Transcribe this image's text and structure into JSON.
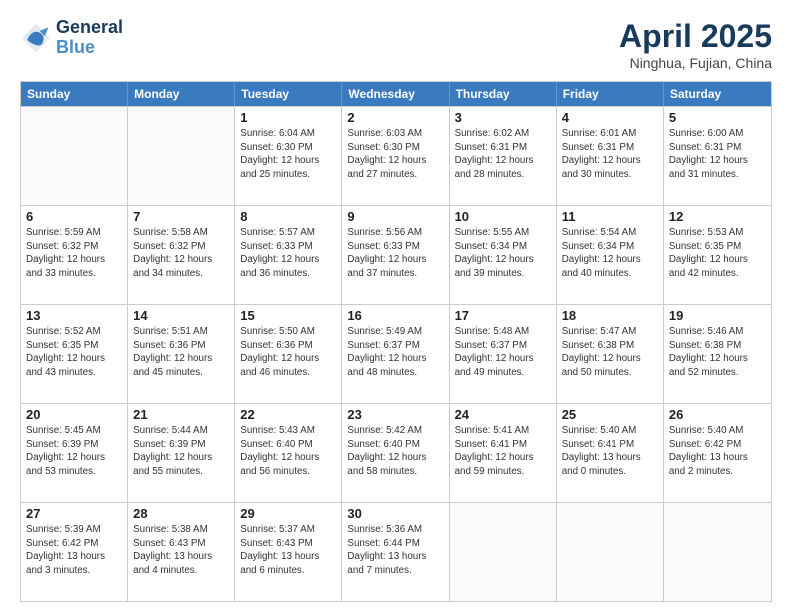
{
  "header": {
    "logo_line1": "General",
    "logo_line2": "Blue",
    "month": "April 2025",
    "location": "Ninghua, Fujian, China"
  },
  "days_of_week": [
    "Sunday",
    "Monday",
    "Tuesday",
    "Wednesday",
    "Thursday",
    "Friday",
    "Saturday"
  ],
  "weeks": [
    [
      {
        "day": "",
        "sunrise": "",
        "sunset": "",
        "daylight": ""
      },
      {
        "day": "",
        "sunrise": "",
        "sunset": "",
        "daylight": ""
      },
      {
        "day": "1",
        "sunrise": "Sunrise: 6:04 AM",
        "sunset": "Sunset: 6:30 PM",
        "daylight": "Daylight: 12 hours and 25 minutes."
      },
      {
        "day": "2",
        "sunrise": "Sunrise: 6:03 AM",
        "sunset": "Sunset: 6:30 PM",
        "daylight": "Daylight: 12 hours and 27 minutes."
      },
      {
        "day": "3",
        "sunrise": "Sunrise: 6:02 AM",
        "sunset": "Sunset: 6:31 PM",
        "daylight": "Daylight: 12 hours and 28 minutes."
      },
      {
        "day": "4",
        "sunrise": "Sunrise: 6:01 AM",
        "sunset": "Sunset: 6:31 PM",
        "daylight": "Daylight: 12 hours and 30 minutes."
      },
      {
        "day": "5",
        "sunrise": "Sunrise: 6:00 AM",
        "sunset": "Sunset: 6:31 PM",
        "daylight": "Daylight: 12 hours and 31 minutes."
      }
    ],
    [
      {
        "day": "6",
        "sunrise": "Sunrise: 5:59 AM",
        "sunset": "Sunset: 6:32 PM",
        "daylight": "Daylight: 12 hours and 33 minutes."
      },
      {
        "day": "7",
        "sunrise": "Sunrise: 5:58 AM",
        "sunset": "Sunset: 6:32 PM",
        "daylight": "Daylight: 12 hours and 34 minutes."
      },
      {
        "day": "8",
        "sunrise": "Sunrise: 5:57 AM",
        "sunset": "Sunset: 6:33 PM",
        "daylight": "Daylight: 12 hours and 36 minutes."
      },
      {
        "day": "9",
        "sunrise": "Sunrise: 5:56 AM",
        "sunset": "Sunset: 6:33 PM",
        "daylight": "Daylight: 12 hours and 37 minutes."
      },
      {
        "day": "10",
        "sunrise": "Sunrise: 5:55 AM",
        "sunset": "Sunset: 6:34 PM",
        "daylight": "Daylight: 12 hours and 39 minutes."
      },
      {
        "day": "11",
        "sunrise": "Sunrise: 5:54 AM",
        "sunset": "Sunset: 6:34 PM",
        "daylight": "Daylight: 12 hours and 40 minutes."
      },
      {
        "day": "12",
        "sunrise": "Sunrise: 5:53 AM",
        "sunset": "Sunset: 6:35 PM",
        "daylight": "Daylight: 12 hours and 42 minutes."
      }
    ],
    [
      {
        "day": "13",
        "sunrise": "Sunrise: 5:52 AM",
        "sunset": "Sunset: 6:35 PM",
        "daylight": "Daylight: 12 hours and 43 minutes."
      },
      {
        "day": "14",
        "sunrise": "Sunrise: 5:51 AM",
        "sunset": "Sunset: 6:36 PM",
        "daylight": "Daylight: 12 hours and 45 minutes."
      },
      {
        "day": "15",
        "sunrise": "Sunrise: 5:50 AM",
        "sunset": "Sunset: 6:36 PM",
        "daylight": "Daylight: 12 hours and 46 minutes."
      },
      {
        "day": "16",
        "sunrise": "Sunrise: 5:49 AM",
        "sunset": "Sunset: 6:37 PM",
        "daylight": "Daylight: 12 hours and 48 minutes."
      },
      {
        "day": "17",
        "sunrise": "Sunrise: 5:48 AM",
        "sunset": "Sunset: 6:37 PM",
        "daylight": "Daylight: 12 hours and 49 minutes."
      },
      {
        "day": "18",
        "sunrise": "Sunrise: 5:47 AM",
        "sunset": "Sunset: 6:38 PM",
        "daylight": "Daylight: 12 hours and 50 minutes."
      },
      {
        "day": "19",
        "sunrise": "Sunrise: 5:46 AM",
        "sunset": "Sunset: 6:38 PM",
        "daylight": "Daylight: 12 hours and 52 minutes."
      }
    ],
    [
      {
        "day": "20",
        "sunrise": "Sunrise: 5:45 AM",
        "sunset": "Sunset: 6:39 PM",
        "daylight": "Daylight: 12 hours and 53 minutes."
      },
      {
        "day": "21",
        "sunrise": "Sunrise: 5:44 AM",
        "sunset": "Sunset: 6:39 PM",
        "daylight": "Daylight: 12 hours and 55 minutes."
      },
      {
        "day": "22",
        "sunrise": "Sunrise: 5:43 AM",
        "sunset": "Sunset: 6:40 PM",
        "daylight": "Daylight: 12 hours and 56 minutes."
      },
      {
        "day": "23",
        "sunrise": "Sunrise: 5:42 AM",
        "sunset": "Sunset: 6:40 PM",
        "daylight": "Daylight: 12 hours and 58 minutes."
      },
      {
        "day": "24",
        "sunrise": "Sunrise: 5:41 AM",
        "sunset": "Sunset: 6:41 PM",
        "daylight": "Daylight: 12 hours and 59 minutes."
      },
      {
        "day": "25",
        "sunrise": "Sunrise: 5:40 AM",
        "sunset": "Sunset: 6:41 PM",
        "daylight": "Daylight: 13 hours and 0 minutes."
      },
      {
        "day": "26",
        "sunrise": "Sunrise: 5:40 AM",
        "sunset": "Sunset: 6:42 PM",
        "daylight": "Daylight: 13 hours and 2 minutes."
      }
    ],
    [
      {
        "day": "27",
        "sunrise": "Sunrise: 5:39 AM",
        "sunset": "Sunset: 6:42 PM",
        "daylight": "Daylight: 13 hours and 3 minutes."
      },
      {
        "day": "28",
        "sunrise": "Sunrise: 5:38 AM",
        "sunset": "Sunset: 6:43 PM",
        "daylight": "Daylight: 13 hours and 4 minutes."
      },
      {
        "day": "29",
        "sunrise": "Sunrise: 5:37 AM",
        "sunset": "Sunset: 6:43 PM",
        "daylight": "Daylight: 13 hours and 6 minutes."
      },
      {
        "day": "30",
        "sunrise": "Sunrise: 5:36 AM",
        "sunset": "Sunset: 6:44 PM",
        "daylight": "Daylight: 13 hours and 7 minutes."
      },
      {
        "day": "",
        "sunrise": "",
        "sunset": "",
        "daylight": ""
      },
      {
        "day": "",
        "sunrise": "",
        "sunset": "",
        "daylight": ""
      },
      {
        "day": "",
        "sunrise": "",
        "sunset": "",
        "daylight": ""
      }
    ]
  ]
}
